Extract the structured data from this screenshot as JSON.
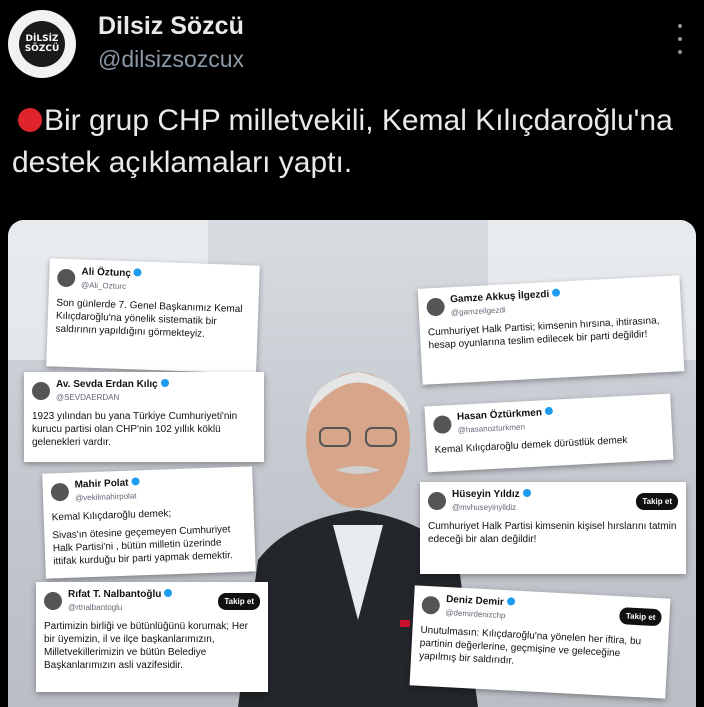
{
  "author": {
    "display_name": "Dilsiz Sözcü",
    "handle": "@dilsizsozcux",
    "avatar_text_top": "DİLSİZ",
    "avatar_text_bottom": "SÖZCÜ"
  },
  "tweet": {
    "text": "Bir grup CHP milletvekili, Kemal Kılıçdaroğlu'na destek açıklamaları yaptı."
  },
  "media_cards": [
    {
      "name": "Ali Öztunç",
      "handle": "@Ali_Ozturc",
      "lines": [
        "Son günlerde 7. Genel Başkanımız Kemal Kılıçdaroğlu'na yönelik sistematik bir saldırının yapıldığını görmekteyiz."
      ]
    },
    {
      "name": "Gamze Akkuş İlgezdi",
      "handle": "@gamzeilgezdi",
      "lines": [
        "Cumhuriyet Halk Partisi; kimsenin hırsına, ihtirasına, hesap oyunlarına teslim edilecek bir parti değildir!"
      ]
    },
    {
      "name": "Av. Sevda Erdan Kılıç",
      "handle": "@SEVDAERDAN",
      "lines": [
        "1923 yılından bu yana Türkiye Cumhuriyeti'nin kurucu partisi olan CHP'nin 102 yıllık köklü gelenekleri vardır."
      ]
    },
    {
      "name": "Hasan Öztürkmen",
      "handle": "@hasanozturkmen",
      "lines": [
        "Kemal Kılıçdaroğlu demek dürüstlük demek"
      ]
    },
    {
      "name": "Mahir Polat",
      "handle": "@vekilmahirpolat",
      "lines": [
        "Kemal Kılıçdaroğlu demek;",
        "Sivas'ın ötesine geçemeyen Cumhuriyet Halk Partisi'ni , bütün milletin üzerinde ittifak kurduğu bir parti yapmak demektir."
      ]
    },
    {
      "name": "Hüseyin Yıldız",
      "handle": "@mvhuseyinyildiz",
      "follow": "Takip et",
      "lines": [
        "Cumhuriyet Halk Partisi kimsenin kişisel hırslarını tatmin edeceği bir alan değildir!"
      ]
    },
    {
      "name": "Rıfat T. Nalbantoğlu",
      "handle": "@rtnalbantoglu",
      "follow": "Takip et",
      "lines": [
        "Partimizin birliği ve bütünlüğünü korumak; Her bir üyemizin, il ve ilçe başkanlarımızın, Milletvekillerimizin ve bütün Belediye Başkanlarımızın asli vazifesidir."
      ]
    },
    {
      "name": "Deniz Demir",
      "handle": "@demirdenizchp",
      "follow": "Takip et",
      "lines": [
        "Unutulmasın: Kılıçdaroğlu'na yönelen her iftira, bu partinin değerlerine, geçmişine ve geleceğine yapılmış bir saldırıdır."
      ]
    }
  ]
}
